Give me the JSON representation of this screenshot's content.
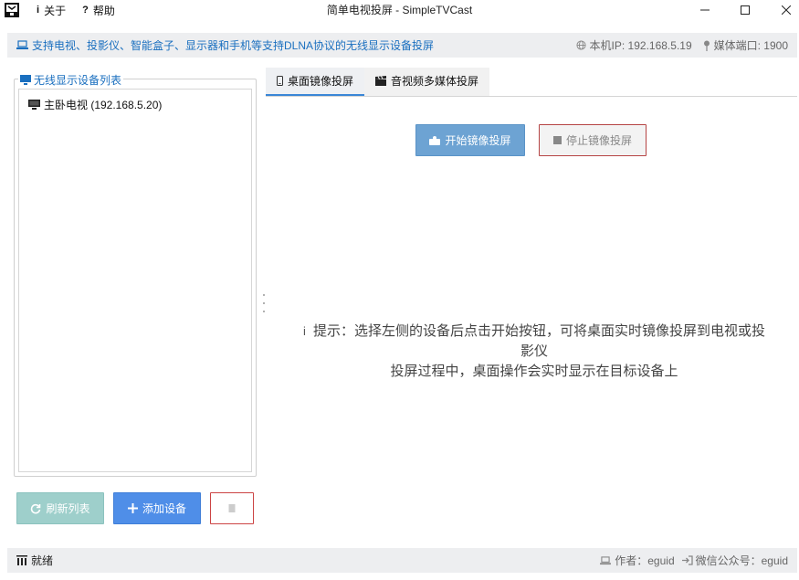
{
  "window": {
    "title": "简单电视投屏 - SimpleTVCast"
  },
  "menu": {
    "about": {
      "glyph": "i",
      "label": "关于"
    },
    "help": {
      "glyph": "?",
      "label": "帮助"
    }
  },
  "infobar": {
    "support_text": "支持电视、投影仪、智能盒子、显示器和手机等支持DLNA协议的无线显示设备投屏",
    "local_ip": "本机IP: 192.168.5.19",
    "media_port": "媒体端口: 1900"
  },
  "device_list": {
    "legend": "无线显示设备列表",
    "devices": [
      {
        "label": "主卧电视 (192.168.5.20)"
      }
    ]
  },
  "left_buttons": {
    "refresh": "刷新列表",
    "add": "添加设备"
  },
  "tabs": [
    {
      "label": "桌面镜像投屏",
      "active": true
    },
    {
      "label": "音视频多媒体投屏",
      "active": false
    }
  ],
  "mirror": {
    "start": "开始镜像投屏",
    "stop": "停止镜像投屏",
    "hint_glyph": "i",
    "hint_line1": "提示：选择左侧的设备后点击开始按钮，可将桌面实时镜像投屏到电视或投影仪",
    "hint_line2": "投屏过程中，桌面操作会实时显示在目标设备上"
  },
  "statusbar": {
    "status": "就绪",
    "author": "作者：eguid",
    "wechat": "微信公众号：eguid"
  },
  "colors": {
    "accent": "#1a6fbf",
    "tab_active_border": "#3a86d6",
    "refresh_btn": "#9ecfcb",
    "add_btn": "#4f8ee8",
    "start_btn": "#6da3d3",
    "stop_border": "#b54444"
  },
  "icons": {
    "app": "tv-cast-app-icon",
    "info": "laptop-icon",
    "ip": "globe-icon",
    "port": "pin-icon",
    "legend": "monitor-icon",
    "device": "monitor-icon",
    "refresh": "refresh-icon",
    "add": "plus-icon",
    "delete": "trash-icon",
    "tab_mirror": "phone-icon",
    "tab_media": "clapperboard-icon",
    "start": "cast-icon",
    "stop": "stop-icon",
    "status": "bar-chart-icon",
    "author": "laptop-icon",
    "wechat": "sign-in-icon"
  }
}
